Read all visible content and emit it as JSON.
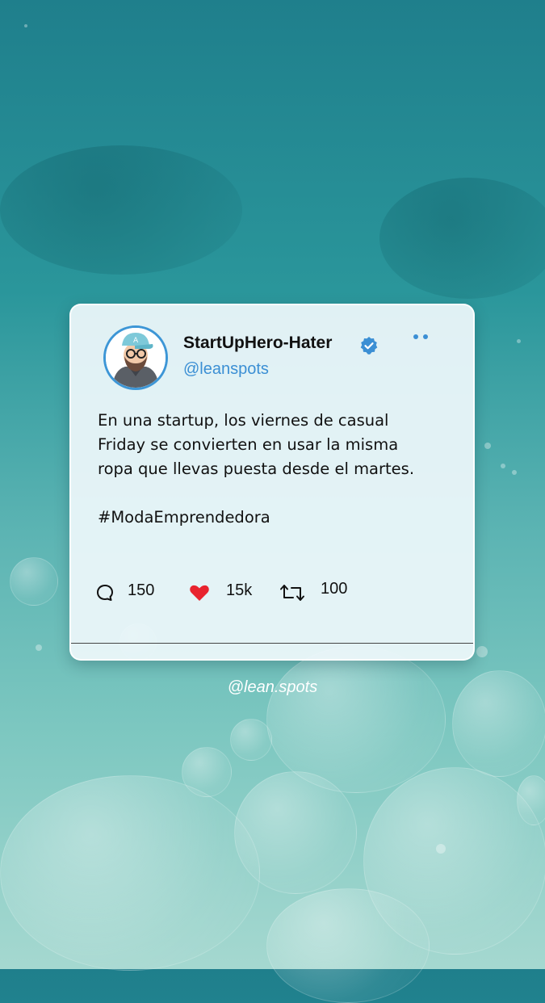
{
  "profile": {
    "name": "StartUpHero-Hater",
    "handle": "@leanspots",
    "verified_icon": "verified-badge-icon",
    "avatar": "avatar-illustration",
    "accent_color": "#3b8fd4"
  },
  "tweet": {
    "text_lines": [
      "En una startup, los viernes de casual",
      "Friday se convierten en usar la misma",
      "ropa que llevas puesta desde el martes."
    ],
    "hashtag": "#ModaEmprendedora"
  },
  "actions": {
    "comments": "150",
    "likes": "15k",
    "retweets": "100",
    "like_color": "#e8232e"
  },
  "footer": {
    "credit": "@lean.spots"
  }
}
